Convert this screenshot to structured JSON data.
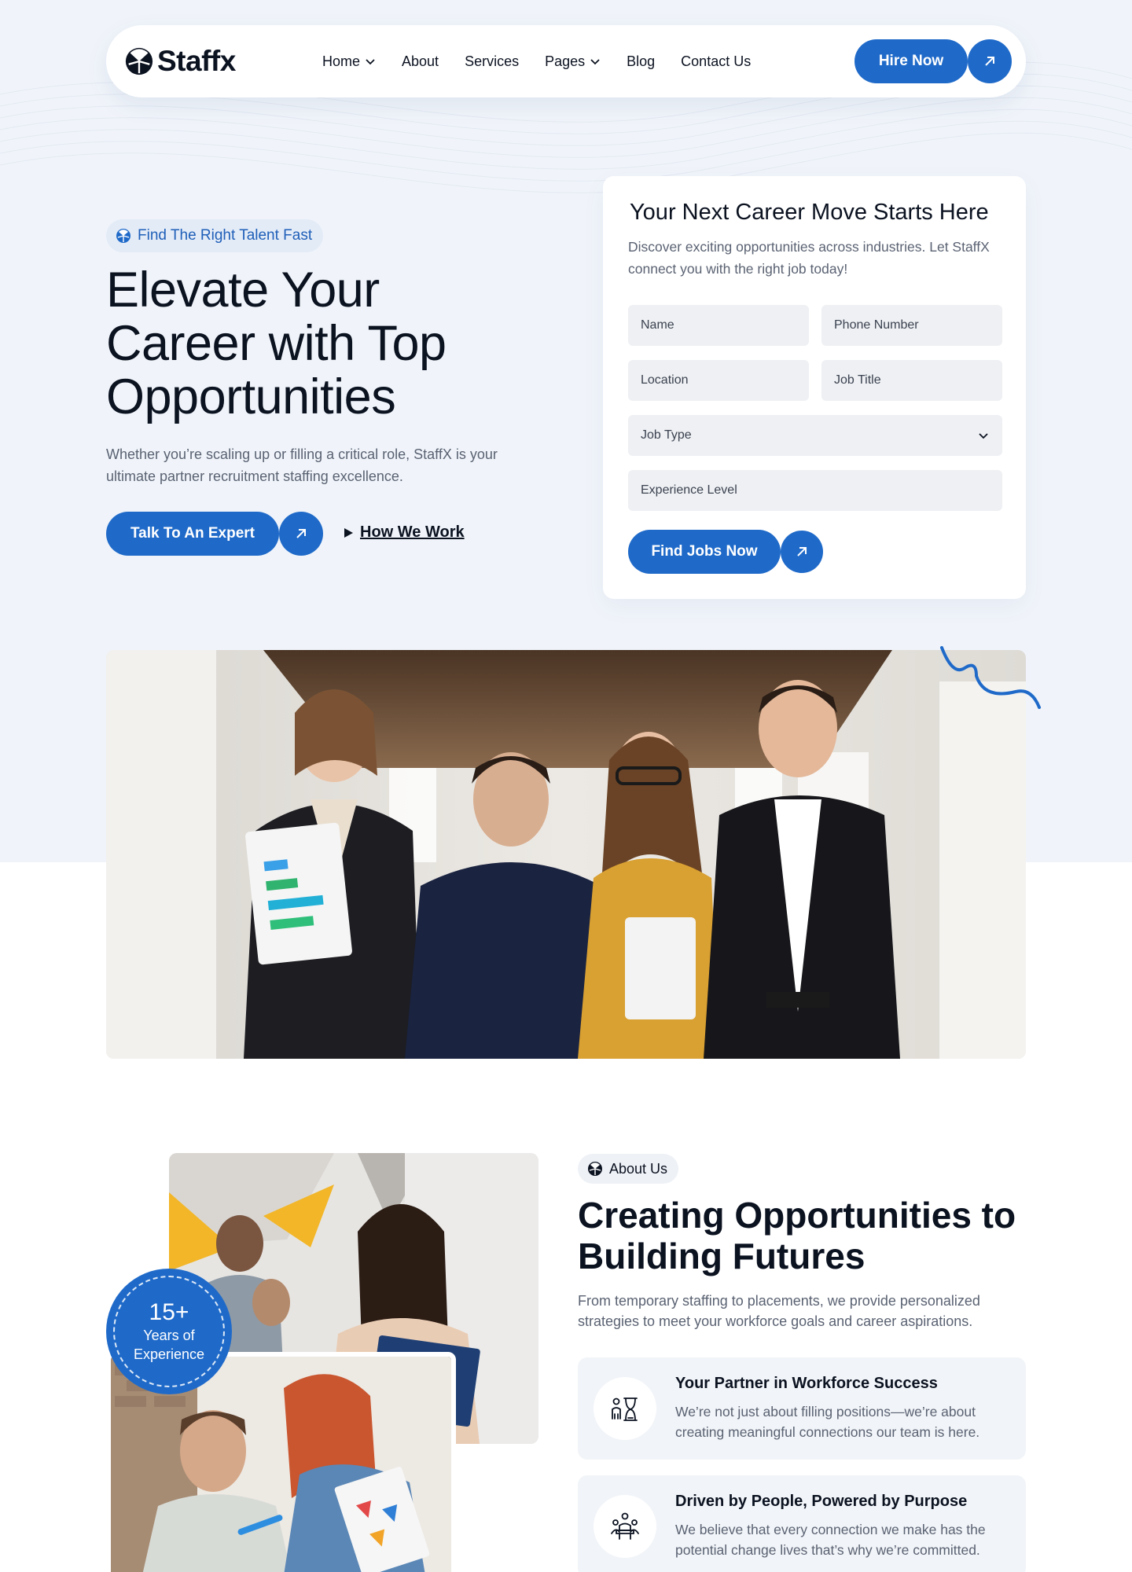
{
  "brand": {
    "name": "Staffx",
    "accent": "#1f6ac9"
  },
  "nav": {
    "items": [
      {
        "label": "Home",
        "has_dropdown": true
      },
      {
        "label": "About",
        "has_dropdown": false
      },
      {
        "label": "Services",
        "has_dropdown": false
      },
      {
        "label": "Pages",
        "has_dropdown": true
      },
      {
        "label": "Blog",
        "has_dropdown": false
      },
      {
        "label": "Contact Us",
        "has_dropdown": false
      }
    ],
    "cta_label": "Hire Now"
  },
  "hero": {
    "badge": "Find The Right Talent Fast",
    "title_lines": [
      "Elevate Your",
      "Career with Top",
      "Opportunities"
    ],
    "description": "Whether you’re scaling up or filling a critical role, StaffX is your ultimate partner recruitment staffing excellence.",
    "primary_cta": "Talk To An Expert",
    "secondary_cta": "How We Work"
  },
  "form": {
    "title": "Your Next Career Move Starts Here",
    "description": "Discover exciting opportunities across industries. Let StaffX connect you with the right job today!",
    "fields": {
      "name": "Name",
      "phone": "Phone Number",
      "location": "Location",
      "job_title": "Job Title",
      "job_type": "Job Type",
      "experience": "Experience Level"
    },
    "submit_label": "Find Jobs Now"
  },
  "about": {
    "badge": "About Us",
    "title": "Creating Opportunities to Building Futures",
    "description": "From temporary staffing to placements, we provide personalized strategies to meet your workforce goals and career aspirations.",
    "experience": {
      "value": "15+",
      "label_1": "Years of",
      "label_2": "Experience"
    },
    "features": [
      {
        "icon": "people-hourglass-icon",
        "title": "Your Partner in Workforce Success",
        "description": "We’re not just about filling positions—we’re about creating meaningful connections our team is here."
      },
      {
        "icon": "team-meeting-icon",
        "title": "Driven by People, Powered by Purpose",
        "description": "We believe that every connection we make has the potential change lives that’s why we’re committed."
      }
    ]
  }
}
